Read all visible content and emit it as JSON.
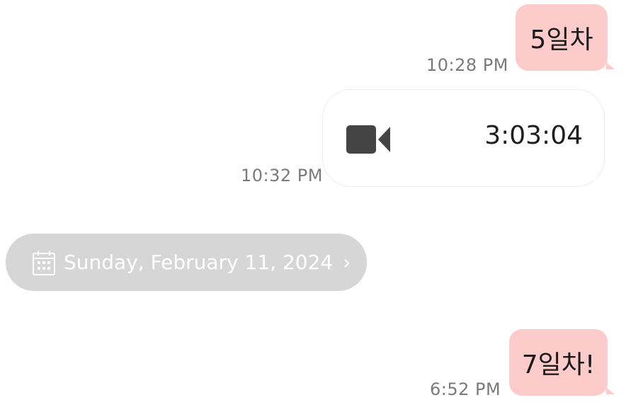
{
  "messages": [
    {
      "text": "5일차",
      "time": "10:28 PM"
    },
    {
      "call_duration": "3:03:04",
      "time": "10:32 PM",
      "icon": "video-camera-icon"
    },
    {
      "text": "7일차!",
      "time": "6:52 PM"
    }
  ],
  "date_divider": {
    "label": "Sunday, February 11, 2024",
    "chevron": "›",
    "icon": "calendar-icon"
  },
  "colors": {
    "sent_bubble": "#fecbcb",
    "date_pill": "#d6d6d6",
    "timestamp": "#7a7a7a",
    "icon": "#444444"
  }
}
